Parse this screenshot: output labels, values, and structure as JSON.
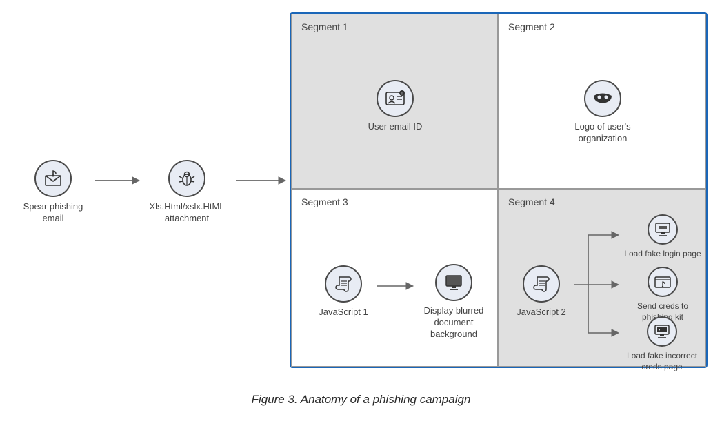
{
  "caption": "Figure 3. Anatomy of a phishing campaign",
  "left_chain": {
    "email": "Spear phishing email",
    "attachment": "Xls.Html/xslx.HtML attachment"
  },
  "segments": {
    "s1": {
      "title": "Segment 1",
      "item": "User email ID"
    },
    "s2": {
      "title": "Segment 2",
      "item": "Logo of user's organization"
    },
    "s3": {
      "title": "Segment 3",
      "js": "JavaScript 1",
      "result": "Display blurred document background"
    },
    "s4": {
      "title": "Segment 4",
      "js": "JavaScript 2",
      "out1": "Load fake login page",
      "out2": "Send creds to phishing kit",
      "out3": "Load fake incorrect creds page"
    }
  },
  "icons": {
    "email": "envelope-hook-icon",
    "attachment": "bug-icon",
    "userid": "id-badge-icon",
    "logo": "mask-icon",
    "script": "scroll-icon",
    "monitor": "monitor-icon",
    "fakepage": "phishing-page-icon",
    "incorrect": "error-monitor-icon"
  }
}
